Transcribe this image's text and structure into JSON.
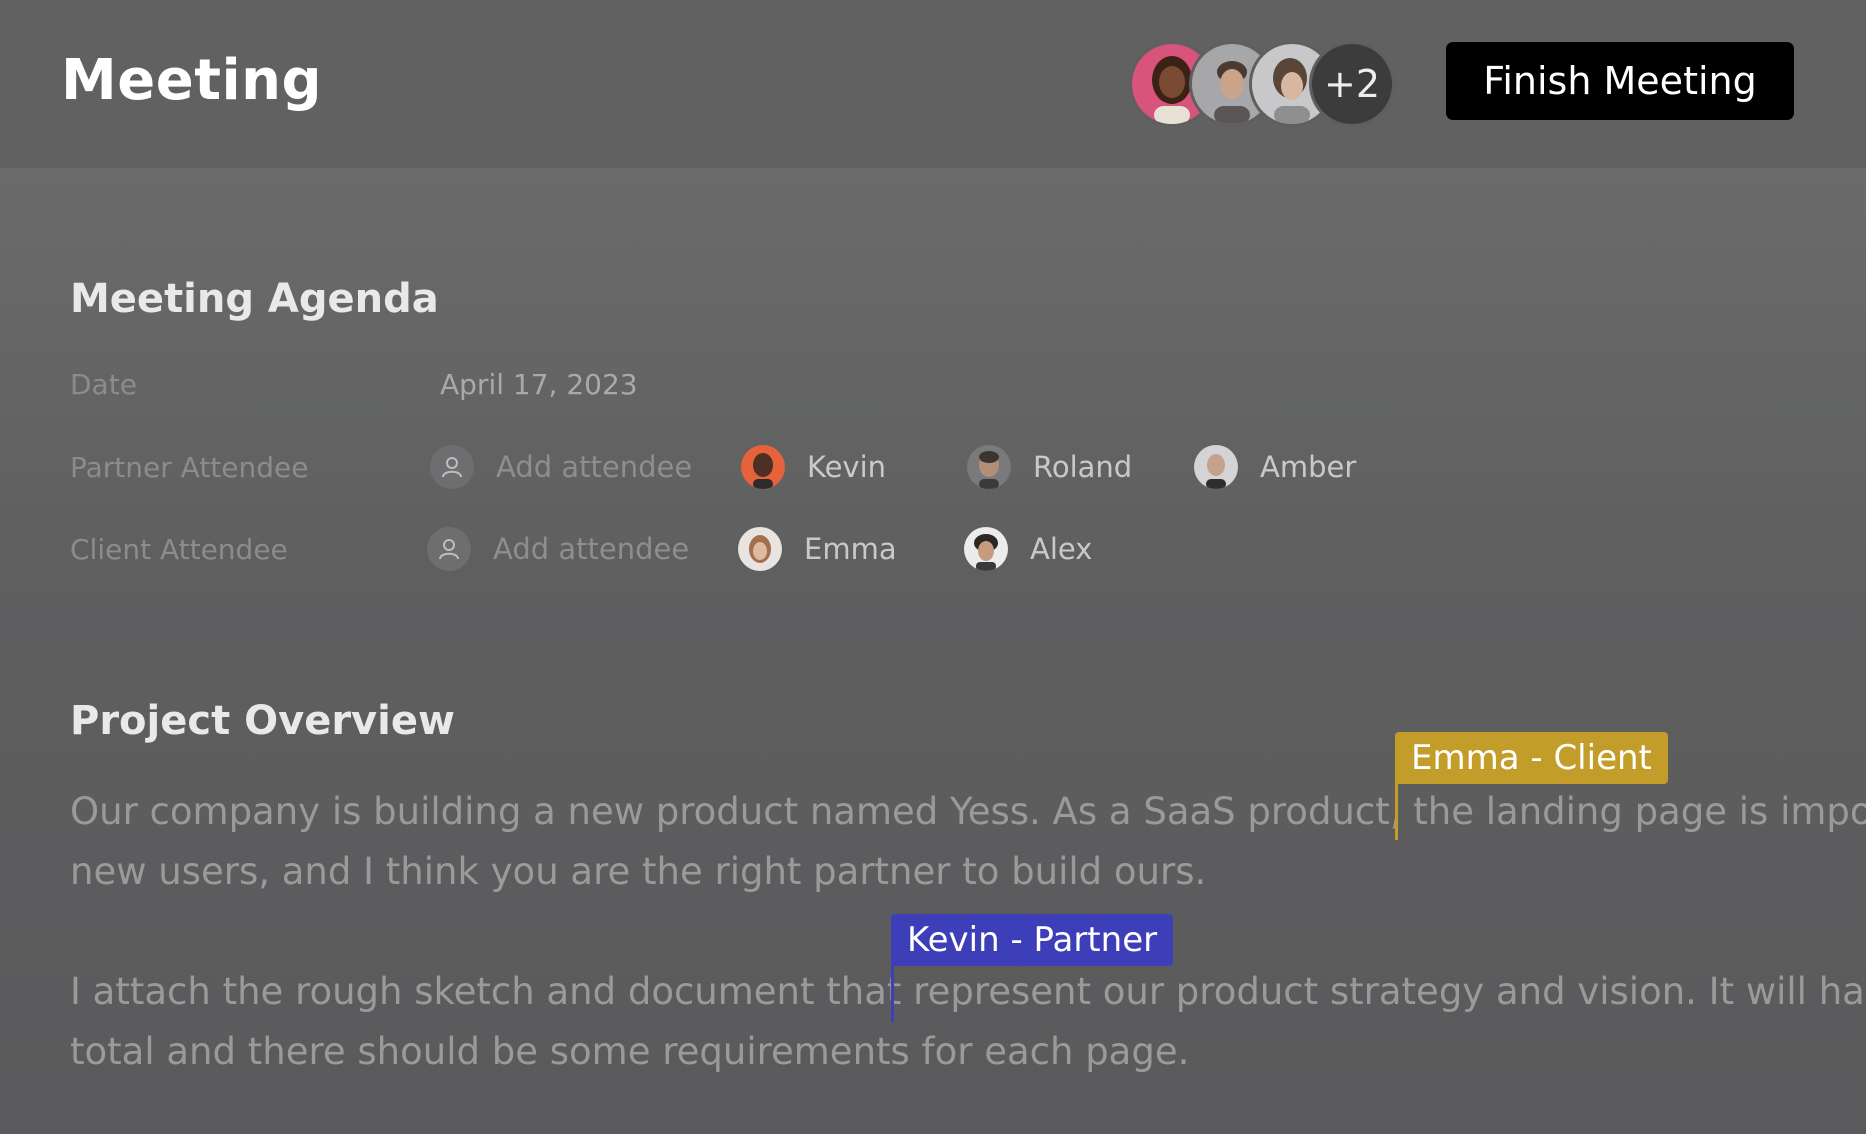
{
  "header": {
    "title": "Meeting",
    "participants_more": "+2",
    "finish_label": "Finish Meeting"
  },
  "agenda": {
    "heading": "Meeting Agenda",
    "date_label": "Date",
    "date_value": "April 17, 2023",
    "partner_label": "Partner Attendee",
    "client_label": "Client Attendee",
    "add_attendee": "Add attendee",
    "partners": [
      "Kevin",
      "Roland",
      "Amber"
    ],
    "clients": [
      "Emma",
      "Alex"
    ]
  },
  "overview": {
    "heading": "Project Overview",
    "line1": "Our company is building a new product named Yess. As a SaaS product, the landing page is impor",
    "line2": "new users, and I think you are the right partner to build ours.",
    "line3": "I attach the rough sketch and document that represent our product strategy and vision. It will have",
    "line4": "total and there should be some requirements for each page."
  },
  "cursors": {
    "client": {
      "label": "Emma - Client",
      "color": "#c39d2a"
    },
    "partner": {
      "label": "Kevin - Partner",
      "color": "#3d3fb9"
    }
  },
  "icons": [
    "person-outline-icon"
  ]
}
